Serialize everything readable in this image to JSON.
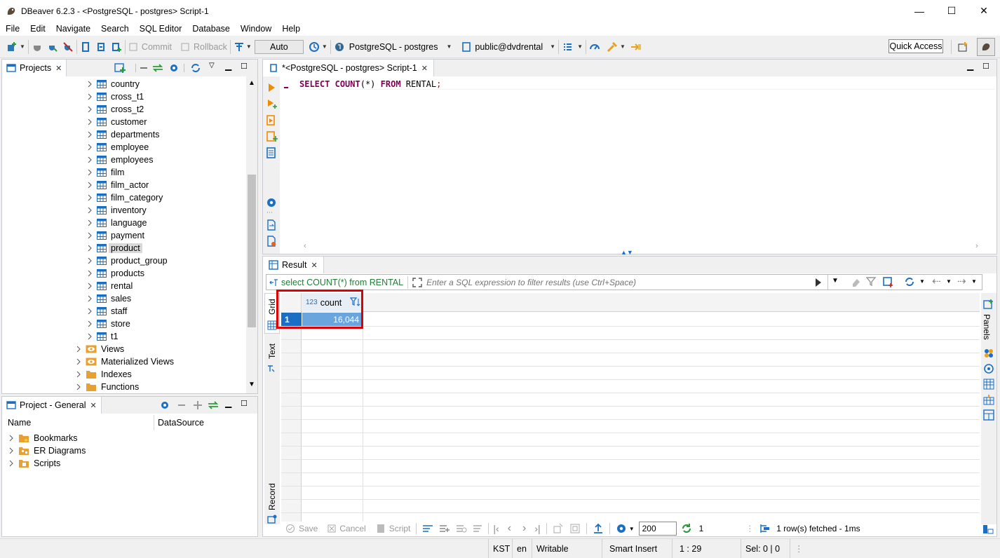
{
  "window": {
    "title": "DBeaver 6.2.3 - <PostgreSQL - postgres> Script-1",
    "minimize": "—",
    "maximize": "☐",
    "close": "✕"
  },
  "menu": [
    "File",
    "Edit",
    "Navigate",
    "Search",
    "SQL Editor",
    "Database",
    "Window",
    "Help"
  ],
  "toolbar": {
    "commit": "Commit",
    "rollback": "Rollback",
    "transaction_mode": "Auto",
    "connection": "PostgreSQL - postgres",
    "schema": "public@dvdrental",
    "quick_access": "Quick Access"
  },
  "projects_panel": {
    "tab": "Projects",
    "tables": [
      "country",
      "cross_t1",
      "cross_t2",
      "customer",
      "departments",
      "employee",
      "employees",
      "film",
      "film_actor",
      "film_category",
      "inventory",
      "language",
      "payment",
      "product",
      "product_group",
      "products",
      "rental",
      "sales",
      "staff",
      "store",
      "t1"
    ],
    "selected": "product",
    "folders": [
      {
        "label": "Views",
        "icon": "views-icon"
      },
      {
        "label": "Materialized Views",
        "icon": "materialized-views-icon"
      },
      {
        "label": "Indexes",
        "icon": "folder-icon"
      },
      {
        "label": "Functions",
        "icon": "folder-icon"
      }
    ]
  },
  "project_general": {
    "tab": "Project - General",
    "columns": [
      "Name",
      "DataSource"
    ],
    "items": [
      "Bookmarks",
      "ER Diagrams",
      "Scripts"
    ]
  },
  "editor": {
    "tab": "*<PostgreSQL - postgres> Script-1",
    "sql_keyword1": "SELECT",
    "sql_func": "COUNT",
    "sql_args": "(*)",
    "sql_keyword2": "FROM",
    "sql_table": "RENTAL",
    "sql_end": ";"
  },
  "results": {
    "tab": "Result",
    "query_label": "select COUNT(*) from RENTAL",
    "filter_placeholder": "Enter a SQL expression to filter results (use Ctrl+Space)",
    "side_tabs": {
      "grid": "Grid",
      "text": "Text",
      "record": "Record"
    },
    "panels_label": "Panels",
    "column_type": "123",
    "column_name": "count",
    "rows": [
      {
        "num": "1",
        "count": "16,044"
      }
    ],
    "bottom": {
      "save": "Save",
      "cancel": "Cancel",
      "script": "Script",
      "fetch_size": "200",
      "refresh_count": "1",
      "fetched": "1 row(s) fetched - 1ms"
    }
  },
  "status": {
    "timezone": "KST",
    "locale": "en",
    "mode": "Writable",
    "insert": "Smart Insert",
    "position": "1 : 29",
    "selection": "Sel: 0 | 0"
  },
  "colors": {
    "accent": "#1a6fc4",
    "highlight_box": "#e00000",
    "keyword": "#7f0055",
    "selected_cell": "#6aa5dd"
  }
}
